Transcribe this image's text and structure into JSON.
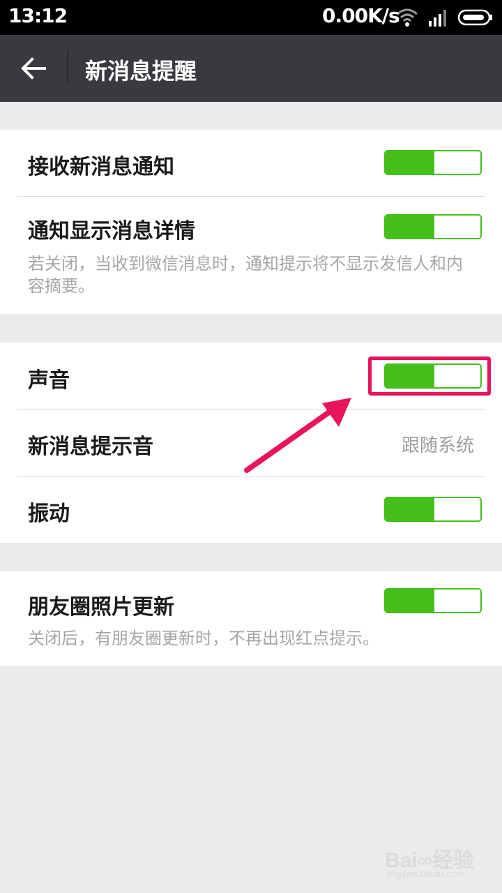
{
  "status_bar": {
    "time": "13:12",
    "net_speed": "0.00K/s",
    "icons": [
      "wifi-icon",
      "signal-icon",
      "battery-icon"
    ]
  },
  "app_bar": {
    "back_icon": "back-arrow-icon",
    "title": "新消息提醒"
  },
  "settings": {
    "receive_notifications": {
      "label": "接收新消息通知",
      "enabled": true
    },
    "show_details": {
      "label": "通知显示消息详情",
      "enabled": true,
      "description": "若关闭，当收到微信消息时，通知提示将不显示发信人和内容摘要。"
    },
    "sound": {
      "label": "声音",
      "enabled": true
    },
    "tone": {
      "label": "新消息提示音",
      "value": "跟随系统"
    },
    "vibration": {
      "label": "振动",
      "enabled": true
    },
    "moments_updates": {
      "label": "朋友圈照片更新",
      "enabled": true,
      "description": "关闭后，有朋友圈更新时，不再出现红点提示。"
    }
  },
  "annotation": {
    "color": "#e8155c"
  },
  "colors": {
    "toggle_on": "#45c01a",
    "app_bar": "#393a3f",
    "background": "#ebebeb"
  },
  "watermark": {
    "brand": "Bai∞经验",
    "url": "jingyan.baidu.com"
  }
}
